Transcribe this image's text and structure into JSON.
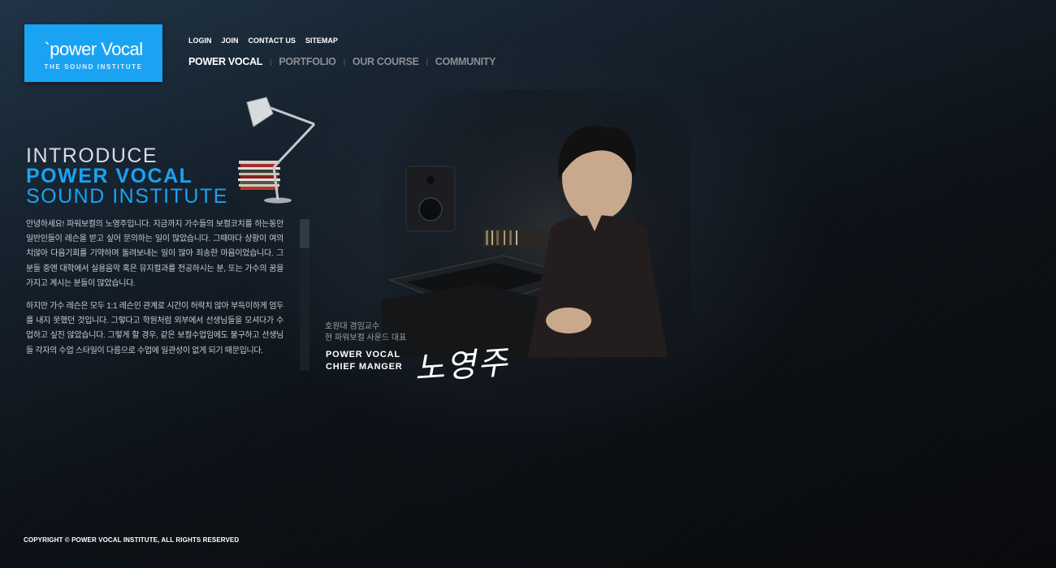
{
  "logo": {
    "main": "`power Vocal",
    "sub": "THE SOUND INSTITUTE"
  },
  "util_nav": [
    "LOGIN",
    "JOIN",
    "CONTACT US",
    "SITEMAP"
  ],
  "main_nav": [
    "POWER VOCAL",
    "PORTFOLIO",
    "OUR COURSE",
    "COMMUNITY"
  ],
  "intro": {
    "line1": "INTRODUCE",
    "line2": "POWER VOCAL",
    "line3": "SOUND INSTITUTE"
  },
  "body": {
    "p1": "안녕하세요! 파워보컬의 노영주입니다. 지금까지 가수들의 보컬코치를 하는동안 일반인들이 레슨을 받고 싶어 문의하는 일이 많았습니다. 그때마다 상황이 여의치않아 다음기회를 기약하며 돌려보내는 일이 많아 죄송한 마음이었습니다. 그 분들 중엔 대학에서 실용음악 혹은 뮤지컬과를 전공하시는 분, 또는 가수의 꿈을 가지고 계시는 분들이 많았습니다.",
    "p2": "하지만 가수 레슨은 모두 1:1 레슨인 관계로 시간이 허락치 않아 부득이하게 엄두를 내지 못했던 것입니다. 그렇다고 학원처럼 외부에서 선생님들을 모셔다가 수업하고 싶진 않았습니다. 그렇게 할 경우, 같은 보컬수업임에도 불구하고 선생님들 각자의 수업 스타일이 다름으로 수업에 일관성이 없게 되기 때문입니다."
  },
  "caption": {
    "line1": "호원대 겸임교수",
    "line2": "현 파워보컬 사운드 대표"
  },
  "role": {
    "line1": "POWER VOCAL",
    "line2": "CHIEF MANGER"
  },
  "signature": "노영주",
  "copyright": "COPYRIGHT © POWER VOCAL INSTITUTE, ALL RIGHTS RESERVED",
  "colors": {
    "accent": "#1aa3f2",
    "nav_inactive": "#8b8f94",
    "background": "#0c1117"
  }
}
